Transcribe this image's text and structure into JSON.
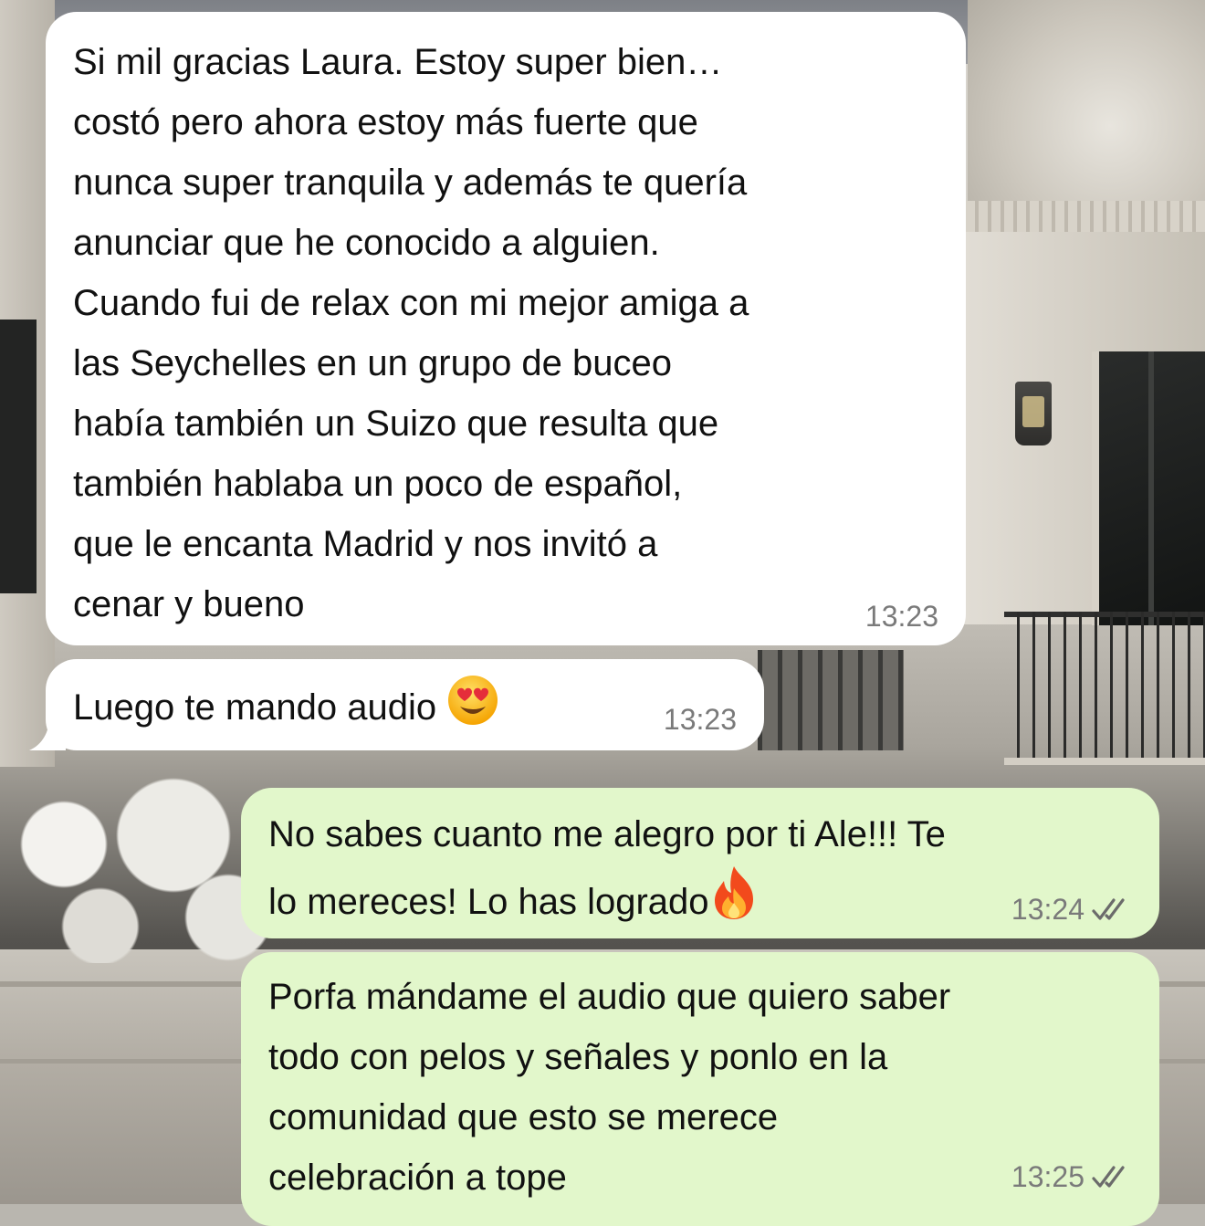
{
  "messages": [
    {
      "direction": "incoming",
      "text": "Si mil gracias Laura. Estoy super bien…\ncostó pero ahora estoy más fuerte que\nnunca super tranquila y además te quería\nanunciar que he conocido a alguien.\nCuando fui de relax con mi mejor amiga a\nlas Seychelles en un grupo de buceo\nhabía también un Suizo que resulta que\ntambién hablaba un poco de español,\nque le encanta Madrid y nos invitó a\ncenar y bueno",
      "time": "13:23"
    },
    {
      "direction": "incoming",
      "text": "Luego te mando audio",
      "emoji": "heart-eyes-emoji",
      "time": "13:23"
    },
    {
      "direction": "outgoing",
      "text": "No sabes cuanto me alegro por ti Ale!!! Te\nlo mereces! Lo has logrado",
      "emoji": "fire-emoji",
      "time": "13:24",
      "status": "read-double-check-icon"
    },
    {
      "direction": "outgoing",
      "text": "Porfa mándame el audio que quiero saber\ntodo con pelos y señales y ponlo en la\ncomunidad que esto se merece\ncelebración a tope",
      "time": "13:25",
      "status": "read-double-check-icon"
    }
  ],
  "colors": {
    "incoming_bubble": "#ffffff",
    "outgoing_bubble": "#e2f7cb",
    "text": "#111111",
    "timestamp": "#7a7a7a"
  }
}
